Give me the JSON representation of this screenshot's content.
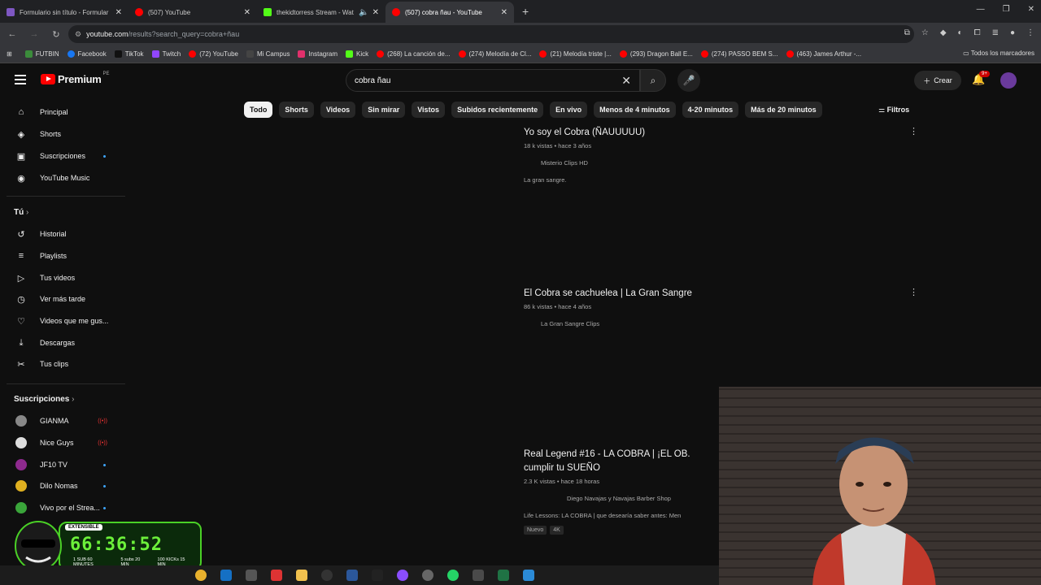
{
  "browser": {
    "tabs": [
      {
        "title": "Formulario sin título - Formular",
        "color": "#7e57c2",
        "active": false
      },
      {
        "title": "(507) YouTube",
        "color": "#ff0000",
        "active": false
      },
      {
        "title": "thekidtorress Stream - Wat",
        "color": "#53fc18",
        "active": false
      },
      {
        "title": "(507) cobra ñau - YouTube",
        "color": "#ff0000",
        "active": true
      }
    ],
    "new_tab": "+",
    "url_host": "youtube.com",
    "url_path": "/results?search_query=cobra+ñau",
    "bookmarks": [
      {
        "label": "FUTBIN",
        "color": "#3b8c3b"
      },
      {
        "label": "Facebook",
        "color": "#1877f2"
      },
      {
        "label": "TikTok",
        "color": "#222222"
      },
      {
        "label": "Twitch",
        "color": "#9146ff"
      },
      {
        "label": "(72) YouTube",
        "color": "#ff0000"
      },
      {
        "label": "Mi Campus",
        "color": "#444444"
      },
      {
        "label": "Instagram",
        "color": "#e1306c"
      },
      {
        "label": "Kick",
        "color": "#53fc18"
      },
      {
        "label": "(268) La canción de...",
        "color": "#ff0000"
      },
      {
        "label": "(274) Melodía de Cl...",
        "color": "#ff0000"
      },
      {
        "label": "(21) Melodía triste |...",
        "color": "#ff0000"
      },
      {
        "label": "(293) Dragon Ball E...",
        "color": "#ff0000"
      },
      {
        "label": "(274) PASSO BEM S...",
        "color": "#ff0000"
      },
      {
        "label": "(463) James Arthur -...",
        "color": "#ff0000"
      }
    ],
    "bookmarks_all": "Todos los marcadores"
  },
  "youtube": {
    "logo_text": "Premium",
    "country": "PE",
    "search_query": "cobra ñau",
    "crear": "Crear",
    "notif_badge": "9+",
    "sidebar_main": [
      {
        "label": "Principal",
        "icon": "home-icon",
        "glyph": "⌂"
      },
      {
        "label": "Shorts",
        "icon": "shorts-icon",
        "glyph": "◈"
      },
      {
        "label": "Suscripciones",
        "icon": "subscriptions-icon",
        "glyph": "▣",
        "dot": true
      },
      {
        "label": "YouTube Music",
        "icon": "music-icon",
        "glyph": "◉"
      }
    ],
    "you_heading": "Tú",
    "sidebar_you": [
      {
        "label": "Historial",
        "icon": "history-icon",
        "glyph": "↺"
      },
      {
        "label": "Playlists",
        "icon": "playlists-icon",
        "glyph": "≡"
      },
      {
        "label": "Tus videos",
        "icon": "your-videos-icon",
        "glyph": "▷"
      },
      {
        "label": "Ver más tarde",
        "icon": "watch-later-icon",
        "glyph": "◷"
      },
      {
        "label": "Videos que me gus...",
        "icon": "like-icon",
        "glyph": "👍"
      },
      {
        "label": "Descargas",
        "icon": "download-icon",
        "glyph": "⤓"
      },
      {
        "label": "Tus clips",
        "icon": "clips-icon",
        "glyph": "✂"
      }
    ],
    "subs_heading": "Suscripciones",
    "subscriptions": [
      {
        "label": "GIANMA",
        "color": "#888888",
        "live": true
      },
      {
        "label": "Nice Guys",
        "color": "#dddddd",
        "live": true
      },
      {
        "label": "JF10 TV",
        "color": "#8e2a8e",
        "dot": true
      },
      {
        "label": "Dilo Nomas",
        "color": "#e0b020",
        "dot": true
      },
      {
        "label": "Vivo por el Strea...",
        "color": "#3aa53a",
        "dot": true
      }
    ],
    "chips": [
      "Todo",
      "Shorts",
      "Videos",
      "Sin mirar",
      "Vistos",
      "Subidos recientemente",
      "En vivo",
      "Menos de 4 minutos",
      "4-20 minutos",
      "Más de 20 minutos"
    ],
    "filters": "Filtros",
    "results": [
      {
        "title": "Yo soy el Cobra (ÑAUUUUU)",
        "meta": "18 k vistas • hace 3 años",
        "channel": "Misterio Clips HD",
        "desc": "La gran sangre."
      },
      {
        "title": "El Cobra se cachuelea | La Gran Sangre",
        "meta": "86 k vistas • hace 4 años",
        "channel": "La Gran Sangre Clips",
        "desc": ""
      },
      {
        "title": "Real Legend #16 - LA COBRA | ¡EL OB... cumplir tu SUEÑO",
        "title_l1": "Real Legend #16 - LA COBRA | ¡EL OB.",
        "title_l2": "cumplir tu SUEÑO",
        "meta": "2.3 K vistas • hace 18 horas",
        "channel": "Diego Navajas y Navajas Barber Shop",
        "desc": "Life Lessons: LA COBRA | que desearía saber antes: Men",
        "tags": [
          "Nuevo",
          "4K"
        ]
      }
    ]
  },
  "overlay": {
    "timer_label": "EXTENSIBLE",
    "timer": "66:36:52",
    "foot": [
      "1 SUB 60 MINUTES",
      "5 subs 20 MIN",
      "100 KICKs 15 MIN"
    ]
  }
}
